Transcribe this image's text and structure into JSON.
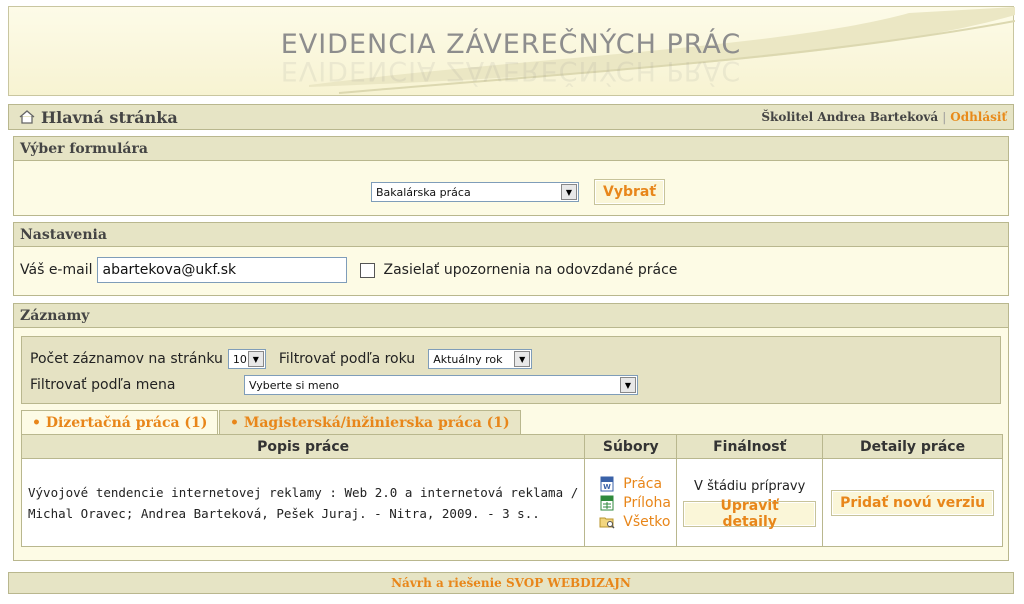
{
  "header": {
    "title": "EVIDENCIA ZÁVEREČNÝCH PRÁC"
  },
  "topbar": {
    "home_label": "Hlavná stránka",
    "user_label": "Školitel Andrea Barteková",
    "logout_label": "Odhlásiť"
  },
  "form_select": {
    "title": "Výber formulára",
    "selected": "Bakalárska práca",
    "submit_label": "Vybrať"
  },
  "settings": {
    "title": "Nastavenia",
    "email_label": "Váš e-mail",
    "email_value": "abartekova@ukf.sk",
    "notify_label": "Zasielať upozornenia na odovzdané práce",
    "notify_checked": false
  },
  "records": {
    "title": "Záznamy",
    "per_page_label": "Počet záznamov na stránku",
    "per_page_value": "10",
    "year_filter_label": "Filtrovať podľa roku",
    "year_filter_value": "Aktuálny rok",
    "name_filter_label": "Filtrovať podľa mena",
    "name_filter_value": "Vyberte si meno",
    "tabs": [
      {
        "label": "• Dizertačná práca (1)",
        "active": false
      },
      {
        "label": "• Magisterská/inžinierska práca (1)",
        "active": true
      }
    ],
    "columns": [
      "Popis práce",
      "Súbory",
      "Finálnosť",
      "Detaily práce"
    ],
    "rows": [
      {
        "description": "Vývojové tendencie internetovej reklamy : Web 2.0 a internetová reklama / Michal Oravec; Andrea Barteková, Pešek Juraj. - Nitra, 2009. - 3 s..",
        "files": [
          "Práca",
          "Príloha",
          "Všetko"
        ],
        "status": "V štádiu prípravy",
        "edit_label": "Upraviť detaily",
        "new_version_label": "Pridať novú verziu"
      }
    ]
  },
  "footer": {
    "text": "Návrh a riešenie SVOP WEBDIZAJN"
  },
  "colors": {
    "accent": "#e8861a",
    "panel_bg": "#fdfbe5",
    "title_bg": "#e6e4c5",
    "border": "#b9b78e"
  }
}
